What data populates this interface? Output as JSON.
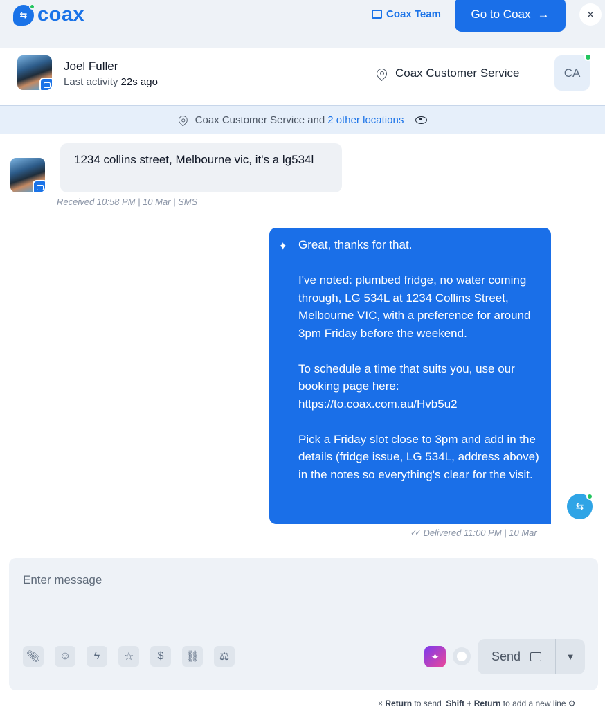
{
  "header": {
    "brand": "coax",
    "team_label": "Coax Team",
    "go_button": "Go to Coax",
    "close": "×"
  },
  "contact": {
    "name": "Joel Fuller",
    "last_activity_label": "Last activity",
    "last_activity_value": "22s ago",
    "location": "Coax Customer Service",
    "agent_initials": "CA"
  },
  "location_bar": {
    "text": "Coax Customer Service and",
    "link": "2 other locations"
  },
  "messages": {
    "incoming": {
      "text": "1234 collins street, Melbourne vic, it's a lg534l",
      "meta": "Received 10:58 PM | 10 Mar | SMS"
    },
    "outgoing": {
      "p1": "Great, thanks for that.",
      "p2": "I've noted: plumbed fridge, no water coming through, LG 534L at 1234 Collins Street, Melbourne VIC, with a preference for around 3pm Friday before the weekend.",
      "p3": "To schedule a time that suits you, use our booking page here:",
      "link": "https://to.coax.com.au/Hvb5u2",
      "p4": "Pick a Friday slot close to 3pm and add in the details (fridge issue, LG 534L, address above) in the notes so everything's clear for the visit.",
      "meta": "Delivered 11:00 PM  |  10 Mar"
    }
  },
  "composer": {
    "placeholder": "Enter message",
    "send_label": "Send"
  },
  "hint": {
    "return_key": "Return",
    "return_text": "to send",
    "shift_key": "Shift + Return",
    "shift_text": "to add a new line"
  }
}
